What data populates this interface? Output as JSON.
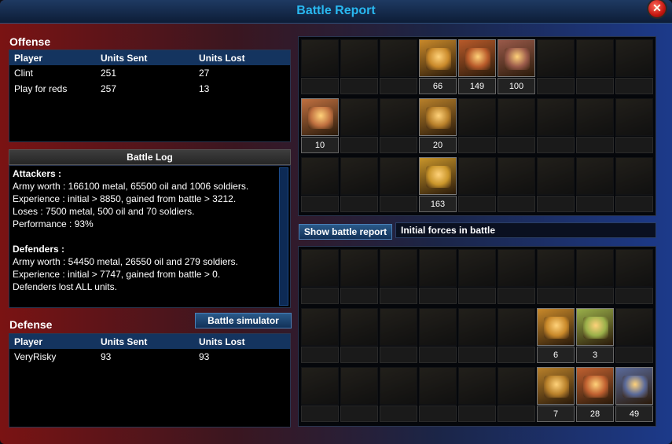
{
  "window": {
    "title": "Battle Report",
    "close_glyph": "✕"
  },
  "offense": {
    "heading": "Offense",
    "columns": [
      "Player",
      "Units Sent",
      "Units Lost"
    ],
    "rows": [
      [
        "Clint",
        "251",
        "27"
      ],
      [
        "Play for reds",
        "257",
        "13"
      ]
    ]
  },
  "battle_log": {
    "heading": "Battle Log",
    "lines": [
      "Attackers :",
      "Army worth : 166100 metal, 65500 oil and 1006 soldiers.",
      "Experience : initial > 8850, gained from battle > 3212.",
      "Loses : 7500 metal, 500 oil and 70 soldiers.",
      "Performance : 93%",
      "",
      "Defenders :",
      "Army worth : 54450 metal, 26550 oil and 279 soldiers.",
      "Experience : initial > 7747, gained from battle > 0.",
      "Defenders lost ALL units."
    ]
  },
  "defense": {
    "heading": "Defense",
    "columns": [
      "Player",
      "Units Sent",
      "Units Lost"
    ],
    "rows": [
      [
        "VeryRisky",
        "93",
        "93"
      ]
    ]
  },
  "buttons": {
    "battle_simulator": "Battle simulator",
    "show_battle_report": "Show battle report"
  },
  "initial_forces_label": "Initial forces in battle",
  "offense_grid": {
    "rows": [
      [
        {
          "icon": "trooper-icon",
          "count": ""
        },
        {
          "icon": "gunner-icon",
          "count": ""
        },
        {
          "icon": "sniper-icon",
          "count": ""
        },
        {
          "icon": "tank-icon",
          "count": "66",
          "active": true,
          "tone": "#c9892a"
        },
        {
          "icon": "heavy-tank-icon",
          "count": "149",
          "active": true,
          "tone": "#b85a2a"
        },
        {
          "icon": "missile-tank-icon",
          "count": "100",
          "active": true,
          "tone": "#9a5a4a"
        },
        {
          "icon": "mech-icon",
          "count": ""
        },
        {
          "icon": "walker-icon",
          "count": ""
        },
        {
          "icon": "robot-icon",
          "count": ""
        }
      ],
      [
        {
          "icon": "flamer-icon",
          "count": "10",
          "active": true,
          "tone": "#c07040"
        },
        {
          "icon": "commando-icon",
          "count": ""
        },
        {
          "icon": "rocket-soldier-icon",
          "count": ""
        },
        {
          "icon": "artillery-icon",
          "count": "20",
          "active": true,
          "tone": "#b8802a"
        },
        {
          "icon": "light-tank-icon",
          "count": ""
        },
        {
          "icon": "apc-icon",
          "count": ""
        },
        {
          "icon": "mech-icon",
          "count": ""
        },
        {
          "icon": "walker-icon",
          "count": ""
        },
        {
          "icon": "robot-icon",
          "count": ""
        }
      ],
      [
        {
          "icon": "infantry-icon",
          "count": ""
        },
        {
          "icon": "medic-icon",
          "count": ""
        },
        {
          "icon": "engineer-icon",
          "count": ""
        },
        {
          "icon": "siege-tank-icon",
          "count": "163",
          "active": true,
          "tone": "#c9952a"
        },
        {
          "icon": "laser-tank-icon",
          "count": ""
        },
        {
          "icon": "plasma-tank-icon",
          "count": ""
        },
        {
          "icon": "mech-icon",
          "count": ""
        },
        {
          "icon": "walker-icon",
          "count": ""
        },
        {
          "icon": "robot-icon",
          "count": ""
        }
      ]
    ]
  },
  "defense_grid": {
    "rows": [
      [
        {
          "icon": "trooper-icon",
          "count": ""
        },
        {
          "icon": "gunner-icon",
          "count": ""
        },
        {
          "icon": "sniper-icon",
          "count": ""
        },
        {
          "icon": "tank-icon",
          "count": ""
        },
        {
          "icon": "heavy-tank-icon",
          "count": ""
        },
        {
          "icon": "missile-tank-icon",
          "count": ""
        },
        {
          "icon": "mech-icon",
          "count": ""
        },
        {
          "icon": "walker-icon",
          "count": ""
        },
        {
          "icon": "robot-icon",
          "count": ""
        }
      ],
      [
        {
          "icon": "flamer-icon",
          "count": ""
        },
        {
          "icon": "commando-icon",
          "count": ""
        },
        {
          "icon": "rocket-soldier-icon",
          "count": ""
        },
        {
          "icon": "artillery-icon",
          "count": ""
        },
        {
          "icon": "light-tank-icon",
          "count": ""
        },
        {
          "icon": "apc-icon",
          "count": ""
        },
        {
          "icon": "mech-icon",
          "count": "6",
          "active": true,
          "tone": "#c9892a"
        },
        {
          "icon": "walker-icon",
          "count": "3",
          "active": true,
          "tone": "#9ab04a"
        },
        {
          "icon": "robot-icon",
          "count": ""
        }
      ],
      [
        {
          "icon": "infantry-icon",
          "count": ""
        },
        {
          "icon": "medic-icon",
          "count": ""
        },
        {
          "icon": "engineer-icon",
          "count": ""
        },
        {
          "icon": "siege-tank-icon",
          "count": ""
        },
        {
          "icon": "laser-tank-icon",
          "count": ""
        },
        {
          "icon": "plasma-tank-icon",
          "count": ""
        },
        {
          "icon": "mech-icon",
          "count": "7",
          "active": true,
          "tone": "#b8802a"
        },
        {
          "icon": "walker-icon",
          "count": "28",
          "active": true,
          "tone": "#c06030"
        },
        {
          "icon": "robot-icon",
          "count": "49",
          "active": true,
          "tone": "#5a6a9a"
        }
      ]
    ]
  }
}
